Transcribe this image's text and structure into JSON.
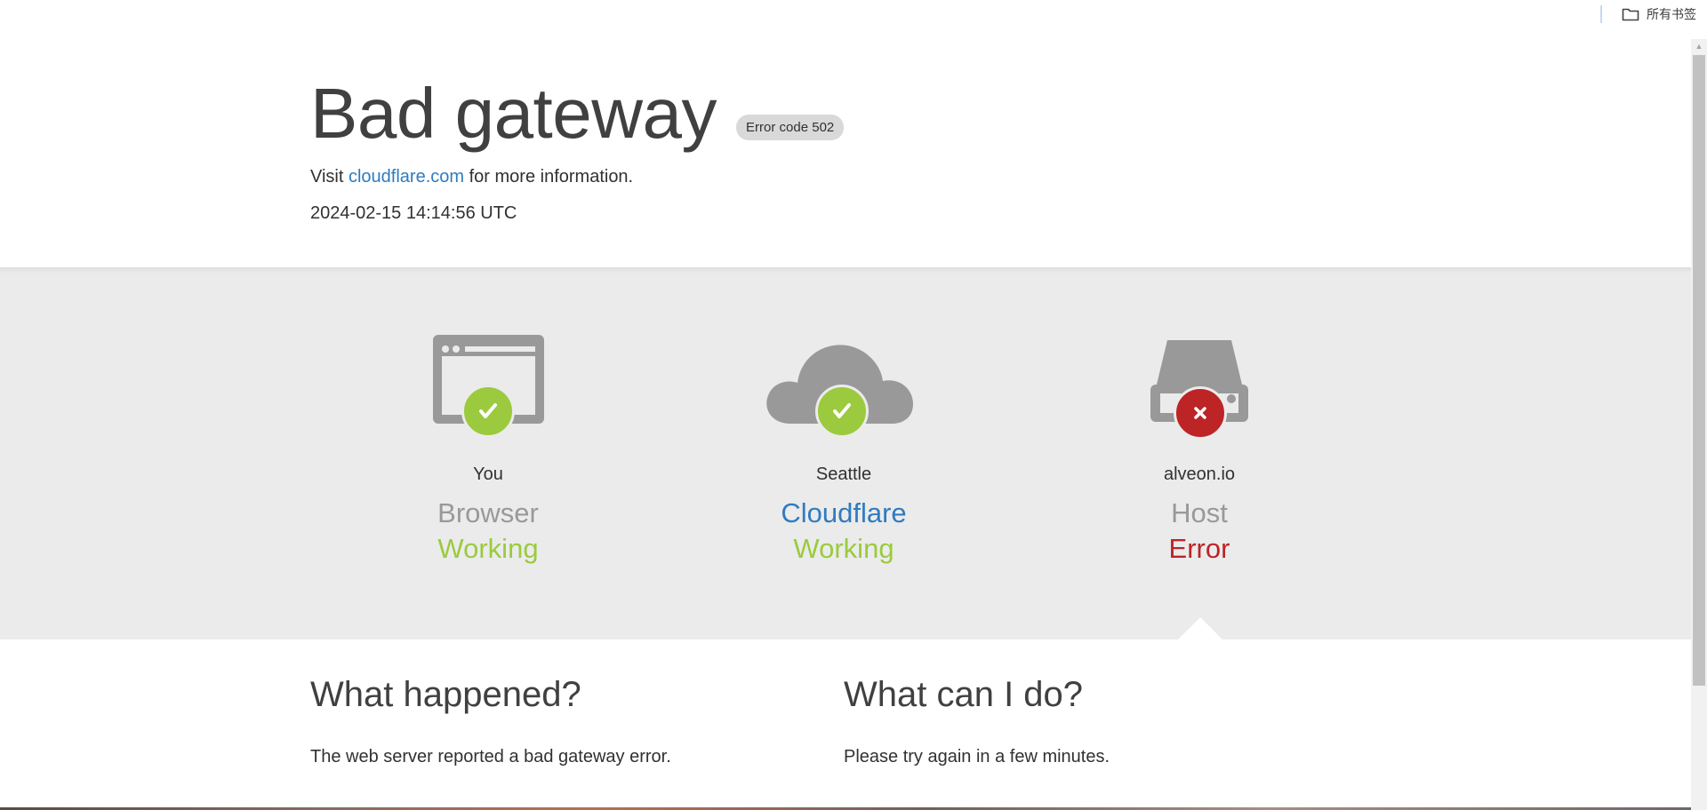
{
  "bookmarks": {
    "all_bookmarks_label": "所有书签"
  },
  "header": {
    "title": "Bad gateway",
    "error_badge": "Error code 502",
    "visit_prefix": "Visit ",
    "visit_link": "cloudflare.com",
    "visit_suffix": " for more information.",
    "timestamp": "2024-02-15 14:14:56 UTC"
  },
  "nodes": [
    {
      "location": "You",
      "name": "Browser",
      "status": "Working",
      "status_icon": "check-icon",
      "icon": "browser-icon"
    },
    {
      "location": "Seattle",
      "name": "Cloudflare",
      "status": "Working",
      "status_icon": "check-icon",
      "icon": "cloud-icon"
    },
    {
      "location": "alveon.io",
      "name": "Host",
      "status": "Error",
      "status_icon": "cross-icon",
      "icon": "server-icon"
    }
  ],
  "explain": {
    "what_happened_title": "What happened?",
    "what_happened_text": "The web server reported a bad gateway error.",
    "what_can_i_do_title": "What can I do?",
    "what_can_i_do_text": "Please try again in a few minutes."
  },
  "colors": {
    "ok": "#9bca3e",
    "error": "#bd2426",
    "link": "#2f7bbf",
    "band": "#ebebeb",
    "icon_gray": "#999999"
  }
}
